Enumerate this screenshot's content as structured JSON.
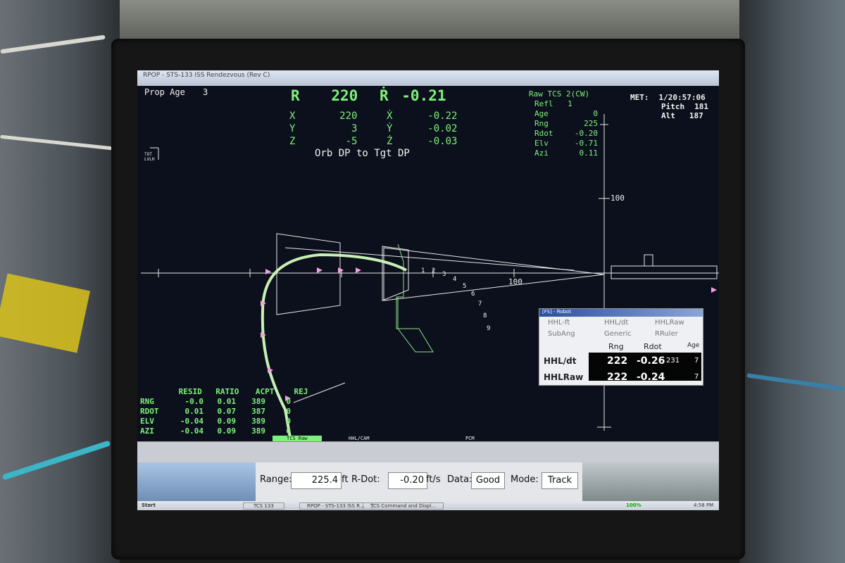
{
  "window": {
    "title": "RPOP - STS-133 ISS Rendezvous (Rev C)"
  },
  "header": {
    "prop_age_label": "Prop Age",
    "prop_age_value": "3",
    "r_label": "R",
    "r_value": "220",
    "rdot_label": "Ṙ",
    "rdot_value": "-0.21",
    "x_label": "X",
    "x_value": "220",
    "xdot_label": "Ẋ",
    "xdot_value": "-0.22",
    "y_label": "Y",
    "y_value": "3",
    "ydot_label": "Ẏ",
    "ydot_value": "-0.02",
    "z_label": "Z",
    "z_value": "-5",
    "zdot_label": "Ż",
    "zdot_value": "-0.03",
    "mode_caption": "Orb DP to Tgt DP"
  },
  "raw_tcs": {
    "title": "Raw TCS 2(CW)",
    "refl_label": "Refl",
    "refl_value": "1",
    "rows": [
      {
        "label": "Age",
        "value": "0"
      },
      {
        "label": "Rng",
        "value": "225"
      },
      {
        "label": "Rdot",
        "value": "-0.20"
      },
      {
        "label": "Elv",
        "value": "-0.71"
      },
      {
        "label": "Azi",
        "value": "0.11"
      }
    ]
  },
  "met": {
    "met_label": "MET:",
    "met_value": "1/20:57:06",
    "pitch_label": "Pitch",
    "pitch_value": "181",
    "alt_label": "Alt",
    "alt_value": "187"
  },
  "frame_label": {
    "top": "TOT",
    "bottom": "LVLH"
  },
  "plot": {
    "axis_label_upper": "100",
    "axis_label_mid": "100",
    "corridor_marks": [
      "1",
      "2",
      "3",
      "4",
      "5",
      "6",
      "7",
      "8",
      "9"
    ]
  },
  "resid_table": {
    "headers": [
      "RESID",
      "RATIO",
      "ACPT",
      "REJ"
    ],
    "rows": [
      {
        "name": "RNG",
        "resid": "-0.0",
        "ratio": "0.01",
        "acpt": "389",
        "rej": "0"
      },
      {
        "name": "RDOT",
        "resid": "0.01",
        "ratio": "0.07",
        "acpt": "387",
        "rej": "0"
      },
      {
        "name": "ELV",
        "resid": "-0.04",
        "ratio": "0.09",
        "acpt": "389",
        "rej": "0"
      },
      {
        "name": "AZI",
        "resid": "-0.04",
        "ratio": "0.09",
        "acpt": "389",
        "rej": "0"
      }
    ]
  },
  "robot_dialog": {
    "title": "[FS] - Robot",
    "options": [
      "HHL-ft",
      "HHL/dt",
      "HHLRaw",
      "SubAng",
      "Generic",
      "RRuler"
    ],
    "col_rng": "Rng",
    "col_rdot": "Rdot",
    "col_age": "Age",
    "rows": [
      {
        "name": "HHL/dt",
        "rng": "222",
        "rdot": "-0.26",
        "extra": "231",
        "age": "7"
      },
      {
        "name": "HHLRaw",
        "rng": "222",
        "rdot": "-0.24",
        "extra": "",
        "age": "7"
      }
    ]
  },
  "tabs": [
    "TCS Raw",
    "HHL/CAM",
    "PCM"
  ],
  "status": {
    "range_label": "Range:",
    "range_value": "225.4",
    "range_unit": "ft",
    "rdot_label": "R-Dot:",
    "rdot_value": "-0.20",
    "rdot_unit": "ft/s",
    "data_label": "Data:",
    "data_value": "Good",
    "mode_label": "Mode:",
    "mode_value": "Track"
  },
  "taskbar": {
    "start": "Start",
    "items": [
      "TCS 133",
      "RPOP - STS-133 ISS R...",
      "TCS Command and Displ..."
    ],
    "zoom": "100%",
    "clock": "4:58 PM"
  },
  "colors": {
    "screen_bg": "#0c101c",
    "accent_green": "#7ff07a",
    "trajectory": "#c8f0b4"
  }
}
